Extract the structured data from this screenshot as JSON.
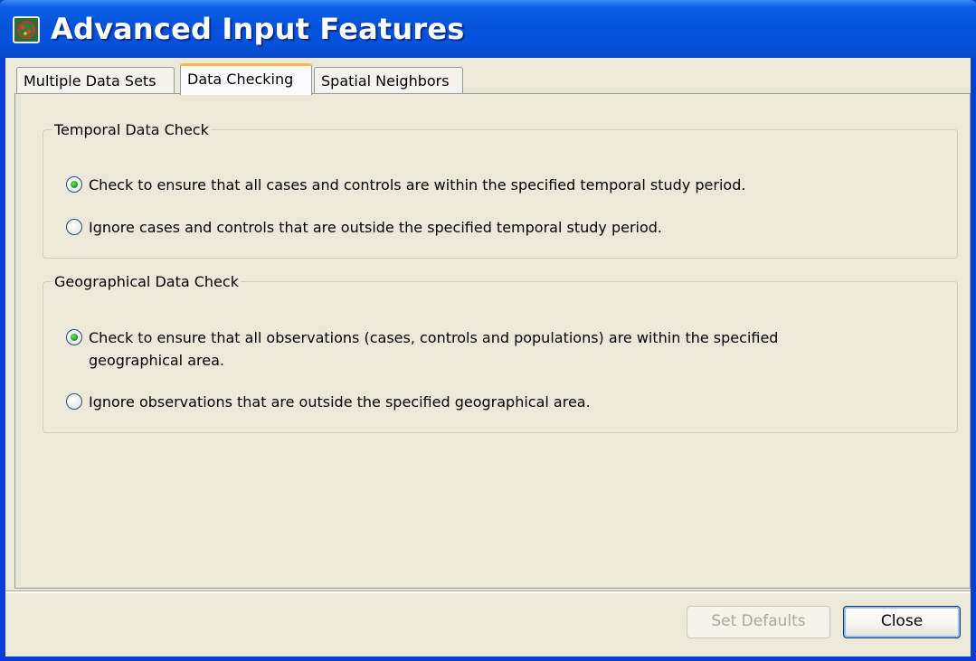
{
  "window": {
    "title": "Advanced Input Features",
    "icon": "app-icon"
  },
  "tabs": [
    {
      "label": "Multiple Data Sets",
      "selected": false
    },
    {
      "label": "Data Checking",
      "selected": true
    },
    {
      "label": "Spatial Neighbors",
      "selected": false
    }
  ],
  "temporal_check": {
    "legend": "Temporal Data Check",
    "options": [
      {
        "label": "Check to ensure that all cases and controls are within the specified temporal study period.",
        "selected": true
      },
      {
        "label": "Ignore cases and controls that are outside the specified temporal study period.",
        "selected": false
      }
    ]
  },
  "geographical_check": {
    "legend": "Geographical Data Check",
    "options": [
      {
        "label_line1": "Check to ensure that all observations (cases, controls and populations) are within the specified",
        "label_line2": "geographical area.",
        "selected": true
      },
      {
        "label": "Ignore observations that are outside the specified geographical area.",
        "selected": false
      }
    ]
  },
  "buttons": {
    "set_defaults": {
      "label": "Set Defaults",
      "enabled": false
    },
    "close": {
      "label": "Close",
      "enabled": true
    }
  },
  "colors": {
    "title_bar": "#0553da",
    "window_bg": "#ece9d8",
    "active_tab_accent": "#f7b64a",
    "radio_selected": "#21a121"
  }
}
